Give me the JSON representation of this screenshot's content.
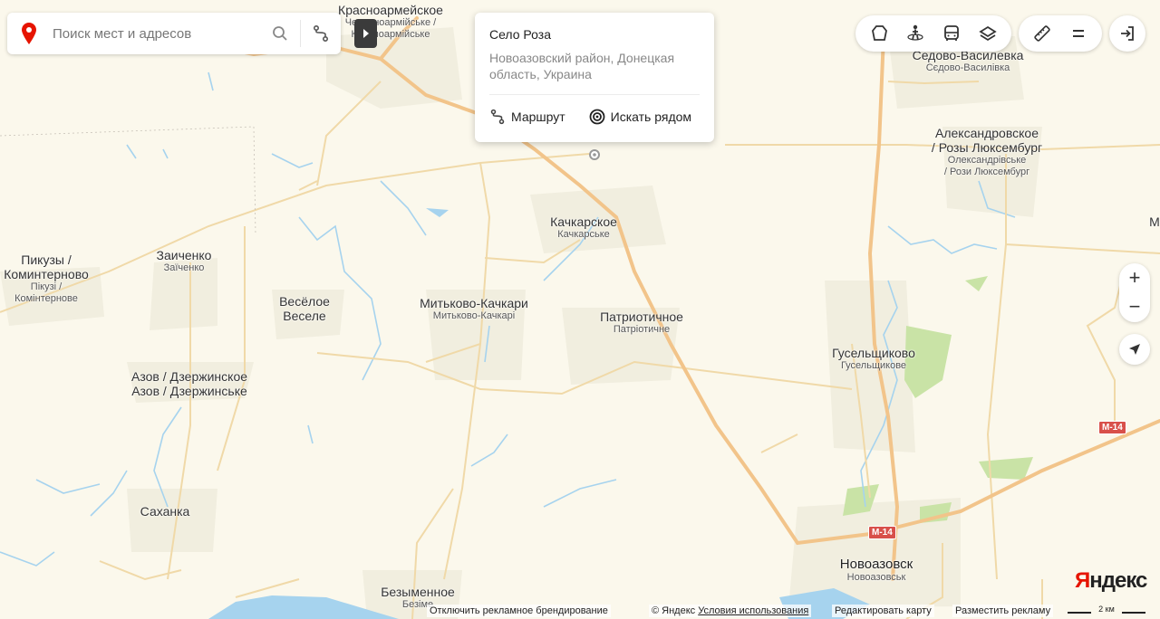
{
  "search": {
    "placeholder": "Поиск мест и адресов"
  },
  "popup": {
    "title": "Село Роза",
    "address": "Новоазовский район, Донецкая область, Украина",
    "route_label": "Маршрут",
    "nearby_label": "Искать рядом"
  },
  "places": [
    {
      "id": "krasnoarmeyskoe",
      "primary": "Красноармейское",
      "secondary": "Красноармійське",
      "secondary_top": "Червоноармійське /"
    },
    {
      "id": "sedovo",
      "primary": "Седово-Василевка",
      "secondary": "Сєдово-Василівка"
    },
    {
      "id": "alexandrovskoe",
      "primary": "Александровское",
      "primary2": "/ Розы Люксембург",
      "secondary": "Олександрівське",
      "secondary2": "/ Рози Люксембург"
    },
    {
      "id": "kachkarskoe",
      "primary": "Качкарское",
      "secondary": "Качкарське"
    },
    {
      "id": "pikuzy",
      "primary": "Пикузы /",
      "primary2": "Комintерново",
      "secondary": "Пікузі /",
      "secondary2": "Комінтернове"
    },
    {
      "id": "zaichenko",
      "primary": "Заиченко",
      "secondary": "Заїченко"
    },
    {
      "id": "veseloe",
      "primary": "Весёлое",
      "secondary": "Веселе"
    },
    {
      "id": "mitkovo",
      "primary": "Митьково-Качкари",
      "secondary": "Митьково-Качкарі"
    },
    {
      "id": "patriotichnoe",
      "primary": "Патриотичное",
      "secondary": "Патріотичне"
    },
    {
      "id": "guselshchikovo",
      "primary": "Гусельщиково",
      "secondary": "Гусельщикове"
    },
    {
      "id": "azov",
      "primary": "Азов / Дзержинское",
      "secondary": "Азов / Дзержинське"
    },
    {
      "id": "sakhanka",
      "primary": "Саханка",
      "secondary": ""
    },
    {
      "id": "bezymennoe",
      "primary": "Безыменное",
      "secondary": "Безіме"
    },
    {
      "id": "novoazovsk",
      "primary": "Новоазовск",
      "secondary": "Новоазовськ"
    },
    {
      "id": "m_partial",
      "primary": "М",
      "secondary": ""
    }
  ],
  "road_shields": [
    "М-14",
    "М-14"
  ],
  "logo": {
    "y": "Я",
    "rest": "ндекс"
  },
  "footer": {
    "disable_branding": "Отключить рекламное брендирование",
    "copyright": "© Яндекс",
    "terms": "Условия использования",
    "edit_map": "Редактировать карту",
    "advertise": "Разместить рекламу",
    "scale": "2 км"
  },
  "controls": {
    "zoom_in": "+",
    "zoom_out": "−"
  },
  "colors": {
    "land": "#fbf8ec",
    "main_road": "#f2c48a",
    "minor_road": "#f0d9a8",
    "water": "#a6d3ee",
    "park": "#c9e3a6",
    "settlement": "#f1eedf",
    "brand_red": "#e61400"
  }
}
